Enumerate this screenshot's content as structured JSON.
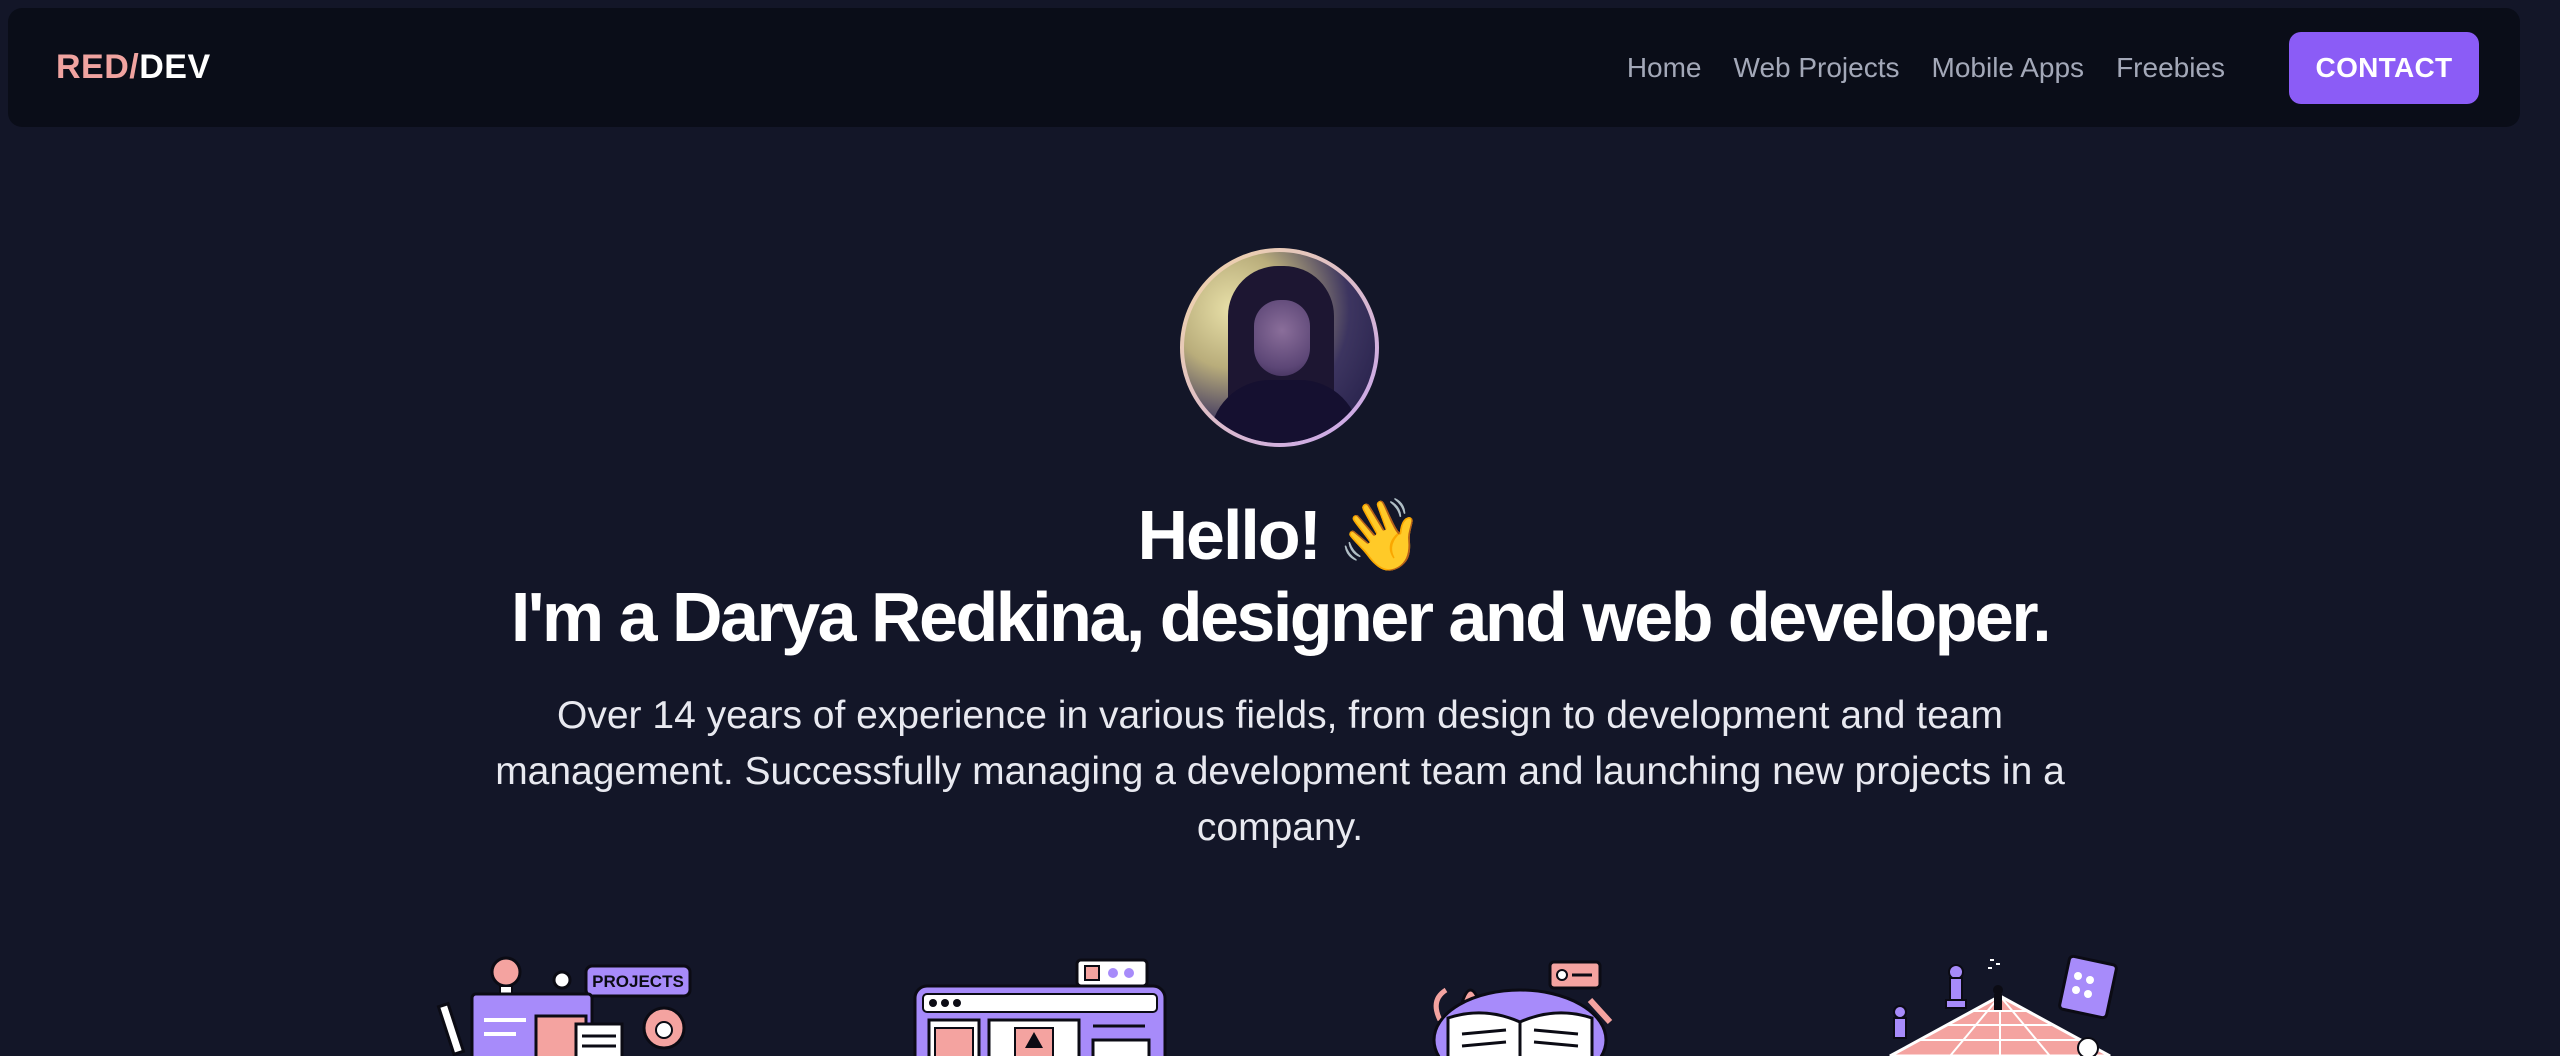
{
  "navbar": {
    "logo": {
      "part1": "RED",
      "separator": "/",
      "part2": "DEV"
    },
    "links": [
      "Home",
      "Web Projects",
      "Mobile Apps",
      "Freebies"
    ],
    "contact_label": "CONTACT"
  },
  "hero": {
    "hello": "Hello! 👋",
    "intro": "I'm a Darya Redkina, designer and web developer.",
    "description": "Over 14 years of experience in various fields, from design to development and team management. Successfully managing a development team and launching new projects in a company."
  },
  "illustrations": [
    {
      "name": "projects-illustration",
      "label": "PROJECTS"
    },
    {
      "name": "web-browser-illustration"
    },
    {
      "name": "open-book-illustration"
    },
    {
      "name": "chess-board-illustration"
    }
  ],
  "colors": {
    "accent": "#8b5cf6",
    "logo_red": "#f0a3a0",
    "background": "#131628",
    "navbar": "#0a0d18",
    "nav_link": "#a3a8b8",
    "illustration_purple": "#a78bfa",
    "illustration_pink": "#f4a3a0"
  }
}
